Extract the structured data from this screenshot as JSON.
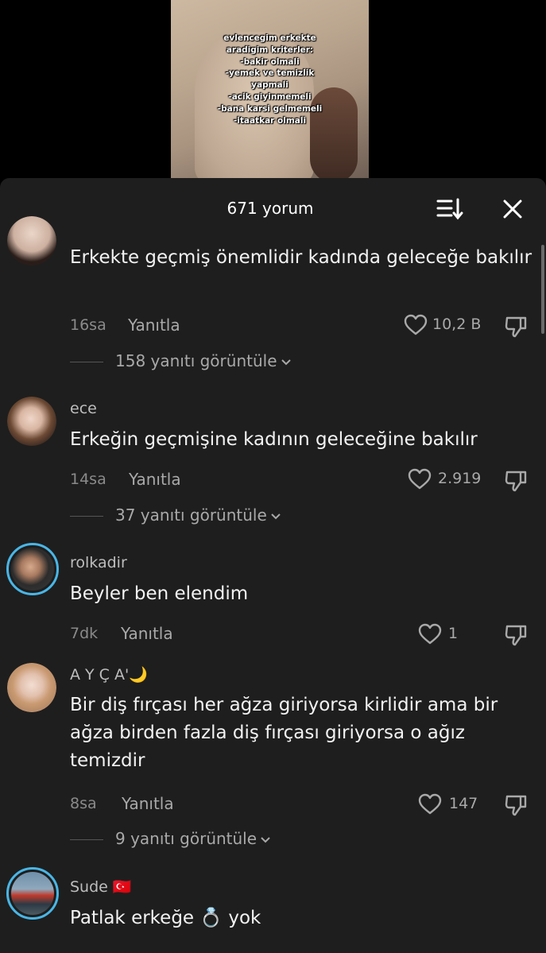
{
  "video": {
    "caption_lines": [
      "evlencegim erkekte",
      "aradigim kriterler:",
      "-bakir olmali",
      "-yemek ve temizlik",
      "yapmali",
      "-acik giyinmemeli",
      "-bana karsi gelmemeli",
      "-itaatkar olmali"
    ]
  },
  "header": {
    "title": "671 yorum",
    "sort_icon": "sort-icon",
    "close_icon": "close-icon"
  },
  "comments": [
    {
      "username": "",
      "text": "Erkekte geçmiş önemlidir kadında geleceğe bakılır",
      "time": "16sa",
      "reply_label": "Yanıtla",
      "likes": "10,2 B",
      "view_replies": "158 yanıtı görüntüle"
    },
    {
      "username": "ece",
      "text": "Erkeğin geçmişine kadının geleceğine bakılır",
      "time": "14sa",
      "reply_label": "Yanıtla",
      "likes": "2.919",
      "view_replies": "37 yanıtı görüntüle"
    },
    {
      "username": "rolkadir",
      "text": "Beyler ben elendim",
      "time": "7dk",
      "reply_label": "Yanıtla",
      "likes": "1",
      "view_replies": ""
    },
    {
      "username": "A Y Ç A'🌙",
      "text": "Bir diş fırçası her ağza giriyorsa kirlidir ama bir ağza birden fazla diş fırçası giriyorsa o ağız temizdir",
      "time": "8sa",
      "reply_label": "Yanıtla",
      "likes": "147",
      "view_replies": "9 yanıtı görüntüle"
    },
    {
      "username": "Sude 🇹🇷",
      "text": "Patlak erkeğe 💍 yok",
      "time": "",
      "reply_label": "",
      "likes": "",
      "view_replies": ""
    }
  ]
}
